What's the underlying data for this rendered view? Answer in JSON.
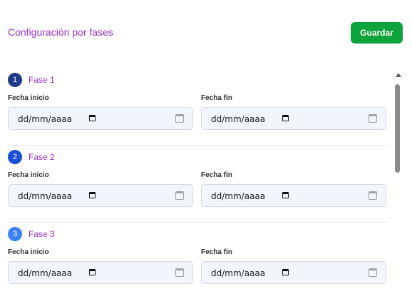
{
  "header": {
    "title": "Configuración por fases",
    "save_label": "Guardar"
  },
  "colors": {
    "accent_text": "#9b30c8",
    "save_button": "#0fa33b",
    "badge_1": "#1e3a8a",
    "badge_2": "#1d4ed8",
    "badge_3": "#3b82f6"
  },
  "phases": [
    {
      "number": "1",
      "name": "Fase 1",
      "start_label": "Fecha inicio",
      "start_value": "dd/mm/aaaa",
      "end_label": "Fecha fin",
      "end_value": "dd/mm/aaaa"
    },
    {
      "number": "2",
      "name": "Fase 2",
      "start_label": "Fecha inicio",
      "start_value": "dd/mm/aaaa",
      "end_label": "Fecha fin",
      "end_value": "dd/mm/aaaa"
    },
    {
      "number": "3",
      "name": "Fase 3",
      "start_label": "Fecha inicio",
      "start_value": "dd/mm/aaaa",
      "end_label": "Fecha fin",
      "end_value": "dd/mm/aaaa"
    }
  ]
}
